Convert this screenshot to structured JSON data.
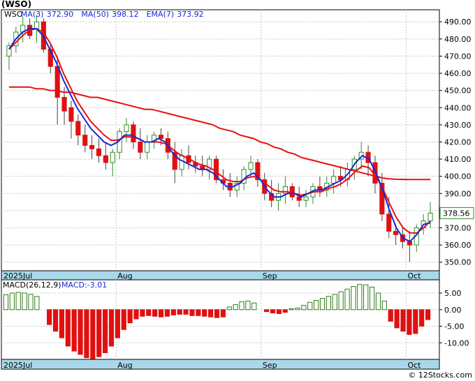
{
  "title": "(WSO)",
  "footer": "© 12Stocks.com",
  "colors": {
    "up": "#2e8b2e",
    "down": "#e01010",
    "ma3": "#1528d6",
    "ma_red": "#e81010",
    "macd_pos": "#2e7d1a",
    "macd_neg": "#e01010",
    "grid": "#c8c8c8",
    "date_bar": "#a8d8ea",
    "price_box": "#2e8b2e"
  },
  "chart_data": [
    {
      "type": "candlestick",
      "ticker": "WSO",
      "legend": [
        {
          "label": "WSO",
          "value": "",
          "color": "#000000"
        },
        {
          "label": "MA(3)",
          "value": "372.90",
          "color": "#1528d6"
        },
        {
          "label": "MA(50)",
          "value": "398.12",
          "color": "#1528d6"
        },
        {
          "label": "EMA(7)",
          "value": "373.92",
          "color": "#1528d6"
        }
      ],
      "ylim": [
        345,
        497
      ],
      "yticks": [
        "490.00",
        "480.00",
        "470.00",
        "460.00",
        "450.00",
        "440.00",
        "430.00",
        "420.00",
        "410.00",
        "400.00",
        "390.00",
        "380.00",
        "370.00",
        "360.00",
        "350.00"
      ],
      "last_price": "378.56",
      "date_labels": [
        {
          "label": "2025Jul",
          "index": 0
        },
        {
          "label": "Aug",
          "index": 16
        },
        {
          "label": "Sep",
          "index": 37
        },
        {
          "label": "Oct",
          "index": 58
        }
      ],
      "ohlc": [
        [
          470,
          478,
          462,
          476
        ],
        [
          476,
          487,
          472,
          484
        ],
        [
          484,
          493,
          478,
          488
        ],
        [
          488,
          492,
          480,
          482
        ],
        [
          486,
          494,
          478,
          490
        ],
        [
          490,
          492,
          472,
          474
        ],
        [
          474,
          478,
          460,
          464
        ],
        [
          464,
          468,
          430,
          446
        ],
        [
          446,
          452,
          430,
          438
        ],
        [
          440,
          444,
          422,
          432
        ],
        [
          432,
          436,
          418,
          424
        ],
        [
          424,
          430,
          414,
          418
        ],
        [
          418,
          424,
          410,
          416
        ],
        [
          416,
          422,
          408,
          412
        ],
        [
          412,
          420,
          404,
          408
        ],
        [
          408,
          416,
          400,
          414
        ],
        [
          414,
          428,
          410,
          426
        ],
        [
          426,
          434,
          420,
          430
        ],
        [
          430,
          432,
          416,
          420
        ],
        [
          420,
          428,
          410,
          414
        ],
        [
          414,
          424,
          410,
          420
        ],
        [
          420,
          426,
          416,
          424
        ],
        [
          424,
          428,
          418,
          422
        ],
        [
          422,
          426,
          410,
          414
        ],
        [
          414,
          420,
          396,
          404
        ],
        [
          404,
          416,
          400,
          412
        ],
        [
          412,
          418,
          404,
          408
        ],
        [
          408,
          412,
          402,
          406
        ],
        [
          406,
          412,
          400,
          404
        ],
        [
          404,
          412,
          398,
          410
        ],
        [
          410,
          412,
          396,
          398
        ],
        [
          398,
          404,
          392,
          396
        ],
        [
          396,
          402,
          388,
          392
        ],
        [
          392,
          400,
          388,
          396
        ],
        [
          396,
          406,
          392,
          404
        ],
        [
          404,
          412,
          400,
          408
        ],
        [
          408,
          410,
          394,
          398
        ],
        [
          398,
          402,
          386,
          390
        ],
        [
          390,
          398,
          382,
          386
        ],
        [
          386,
          396,
          380,
          390
        ],
        [
          390,
          400,
          384,
          394
        ],
        [
          394,
          396,
          386,
          388
        ],
        [
          388,
          394,
          382,
          386
        ],
        [
          386,
          392,
          382,
          388
        ],
        [
          388,
          396,
          384,
          394
        ],
        [
          394,
          400,
          388,
          392
        ],
        [
          392,
          400,
          388,
          396
        ],
        [
          396,
          404,
          390,
          400
        ],
        [
          400,
          406,
          394,
          398
        ],
        [
          398,
          408,
          394,
          404
        ],
        [
          404,
          412,
          398,
          410
        ],
        [
          410,
          420,
          404,
          414
        ],
        [
          414,
          418,
          400,
          408
        ],
        [
          408,
          412,
          390,
          396
        ],
        [
          396,
          402,
          374,
          378
        ],
        [
          378,
          388,
          364,
          368
        ],
        [
          368,
          372,
          360,
          366
        ],
        [
          366,
          370,
          358,
          362
        ],
        [
          362,
          368,
          350,
          360
        ],
        [
          360,
          372,
          356,
          370
        ],
        [
          370,
          378,
          366,
          374
        ],
        [
          374,
          385,
          370,
          378.56
        ]
      ],
      "ma_blue": [
        474,
        480,
        484,
        486,
        486,
        482,
        474,
        466,
        456,
        448,
        440,
        434,
        428,
        424,
        420,
        418,
        420,
        424,
        424,
        422,
        420,
        420,
        422,
        420,
        414,
        410,
        408,
        406,
        404,
        404,
        402,
        398,
        394,
        394,
        396,
        400,
        402,
        398,
        392,
        388,
        388,
        390,
        390,
        388,
        390,
        392,
        392,
        394,
        396,
        398,
        402,
        408,
        412,
        410,
        402,
        392,
        380,
        370,
        364,
        362,
        366,
        372,
        373
      ],
      "ema_red": [
        474,
        478,
        482,
        485,
        486,
        484,
        478,
        470,
        460,
        452,
        444,
        438,
        432,
        428,
        424,
        421,
        421,
        423,
        423,
        422,
        420,
        420,
        420,
        419,
        416,
        413,
        411,
        409,
        407,
        406,
        404,
        401,
        398,
        397,
        397,
        399,
        400,
        398,
        395,
        392,
        391,
        391,
        390,
        389,
        390,
        391,
        391,
        393,
        394,
        396,
        399,
        403,
        406,
        405,
        400,
        393,
        384,
        376,
        370,
        367,
        367,
        370,
        373.9
      ],
      "ma50": [
        452,
        452,
        452,
        452,
        451,
        451,
        450,
        450,
        449,
        449,
        448,
        447,
        446,
        446,
        445,
        444,
        443,
        442,
        441,
        440,
        439,
        439,
        438,
        437,
        436,
        435,
        434,
        433,
        432,
        431,
        430,
        428,
        427,
        426,
        424,
        423,
        422,
        420,
        419,
        417,
        416,
        414,
        413,
        411,
        410,
        409,
        408,
        407,
        406,
        405,
        404,
        403,
        402,
        401,
        400,
        399,
        398.5,
        398.3,
        398.2,
        398.1,
        398.1,
        398.12,
        398.12
      ],
      "macd_label": "MACD(26,12,9)",
      "macd_value_label": "MACD:-3.01",
      "macd_ylim": [
        -15,
        9
      ],
      "macd_yticks": [
        "5.00",
        "0.00",
        "-5.00",
        "-10.00"
      ],
      "macd": [
        4.5,
        5.0,
        5.2,
        5.0,
        4.6,
        4.0,
        0,
        -4.5,
        -6.5,
        -8.5,
        -11,
        -12.5,
        -13.5,
        -14.5,
        -14.8,
        -14.2,
        -13,
        -11,
        -8.5,
        -6,
        -4,
        -2.8,
        -2,
        -1.8,
        -2,
        -2.2,
        -2,
        -1.6,
        -1.4,
        -1.4,
        -1.8,
        -1.8,
        -2,
        -2.2,
        -2.4,
        -2.2,
        0.8,
        1.5,
        2.4,
        2.6,
        2.0,
        0,
        -0.6,
        -1,
        -1.2,
        -0.8,
        0.3,
        0.5,
        1.3,
        2.2,
        2.8,
        3.4,
        4.0,
        4.6,
        5.4,
        6.2,
        7.0,
        7.6,
        7.5,
        6.8,
        5.0,
        2.6,
        -3.5,
        -5.5,
        -6.5,
        -7.5,
        -7.2,
        -5,
        -3.01
      ],
      "macd_colors": [
        "pos",
        "pos",
        "pos",
        "pos",
        "pos",
        "pos",
        "neg",
        "neg",
        "neg",
        "neg",
        "neg",
        "neg",
        "neg",
        "neg",
        "neg",
        "neg",
        "neg",
        "neg",
        "neg",
        "neg",
        "neg",
        "neg",
        "neg",
        "neg",
        "neg",
        "neg",
        "neg",
        "neg",
        "neg",
        "neg",
        "neg",
        "neg",
        "neg",
        "neg",
        "neg",
        "neg",
        "pos",
        "pos",
        "pos",
        "pos",
        "pos",
        "pos",
        "neg",
        "neg",
        "neg",
        "neg",
        "pos",
        "pos",
        "pos",
        "pos",
        "pos",
        "pos",
        "pos",
        "pos",
        "pos",
        "pos",
        "pos",
        "pos",
        "pos",
        "pos",
        "pos",
        "pos",
        "neg",
        "neg",
        "neg",
        "neg",
        "neg",
        "neg",
        "neg"
      ]
    }
  ]
}
